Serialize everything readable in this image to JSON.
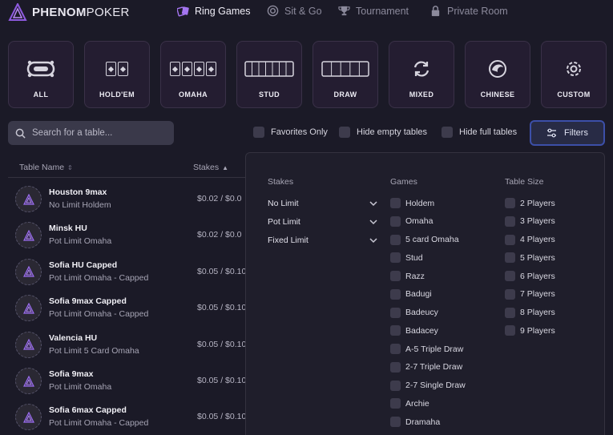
{
  "brand": {
    "bold": "PHENOM",
    "light": "POKER"
  },
  "nav": [
    {
      "label": "Ring Games",
      "icon": "cards-icon",
      "active": true
    },
    {
      "label": "Sit & Go",
      "icon": "chip-icon",
      "active": false
    },
    {
      "label": "Tournament",
      "icon": "trophy-icon",
      "active": false
    },
    {
      "label": "Private Room",
      "icon": "lock-icon",
      "active": false
    }
  ],
  "game_types": [
    "ALL",
    "HOLD'EM",
    "OMAHA",
    "STUD",
    "DRAW",
    "MIXED",
    "CHINESE",
    "CUSTOM"
  ],
  "search": {
    "placeholder": "Search for a table..."
  },
  "toggles": {
    "favorites": "Favorites Only",
    "hide_empty": "Hide empty tables",
    "hide_full": "Hide full tables"
  },
  "filters_label": "Filters",
  "table_header": {
    "name": "Table Name",
    "stakes": "Stakes"
  },
  "tables": [
    {
      "name": "Houston 9max",
      "type": "No Limit Holdem",
      "stakes": "$0.02 / $0.0"
    },
    {
      "name": "Minsk HU",
      "type": "Pot Limit Omaha",
      "stakes": "$0.02 / $0.0"
    },
    {
      "name": "Sofia HU Capped",
      "type": "Pot Limit Omaha - Capped",
      "stakes": "$0.05 / $0.10"
    },
    {
      "name": "Sofia 9max Capped",
      "type": "Pot Limit Omaha - Capped",
      "stakes": "$0.05 / $0.10"
    },
    {
      "name": "Valencia HU",
      "type": "Pot Limit 5 Card Omaha",
      "stakes": "$0.05 / $0.10"
    },
    {
      "name": "Sofia 9max",
      "type": "Pot Limit Omaha",
      "stakes": "$0.05 / $0.10"
    },
    {
      "name": "Sofia 6max Capped",
      "type": "Pot Limit Omaha - Capped",
      "stakes": "$0.05 / $0.10"
    }
  ],
  "panel": {
    "stakes_heading": "Stakes",
    "games_heading": "Games",
    "size_heading": "Table Size",
    "stakes_options": [
      "No Limit",
      "Pot Limit",
      "Fixed Limit"
    ],
    "games": [
      "Holdem",
      "Omaha",
      "5 card Omaha",
      "Stud",
      "Razz",
      "Badugi",
      "Badeucy",
      "Badacey",
      "A-5 Triple Draw",
      "2-7 Triple Draw",
      "2-7 Single Draw",
      "Archie",
      "Dramaha"
    ],
    "sizes": [
      "2 Players",
      "3 Players",
      "4 Players",
      "5 Players",
      "6 Players",
      "7 Players",
      "8 Players",
      "9 Players"
    ]
  }
}
